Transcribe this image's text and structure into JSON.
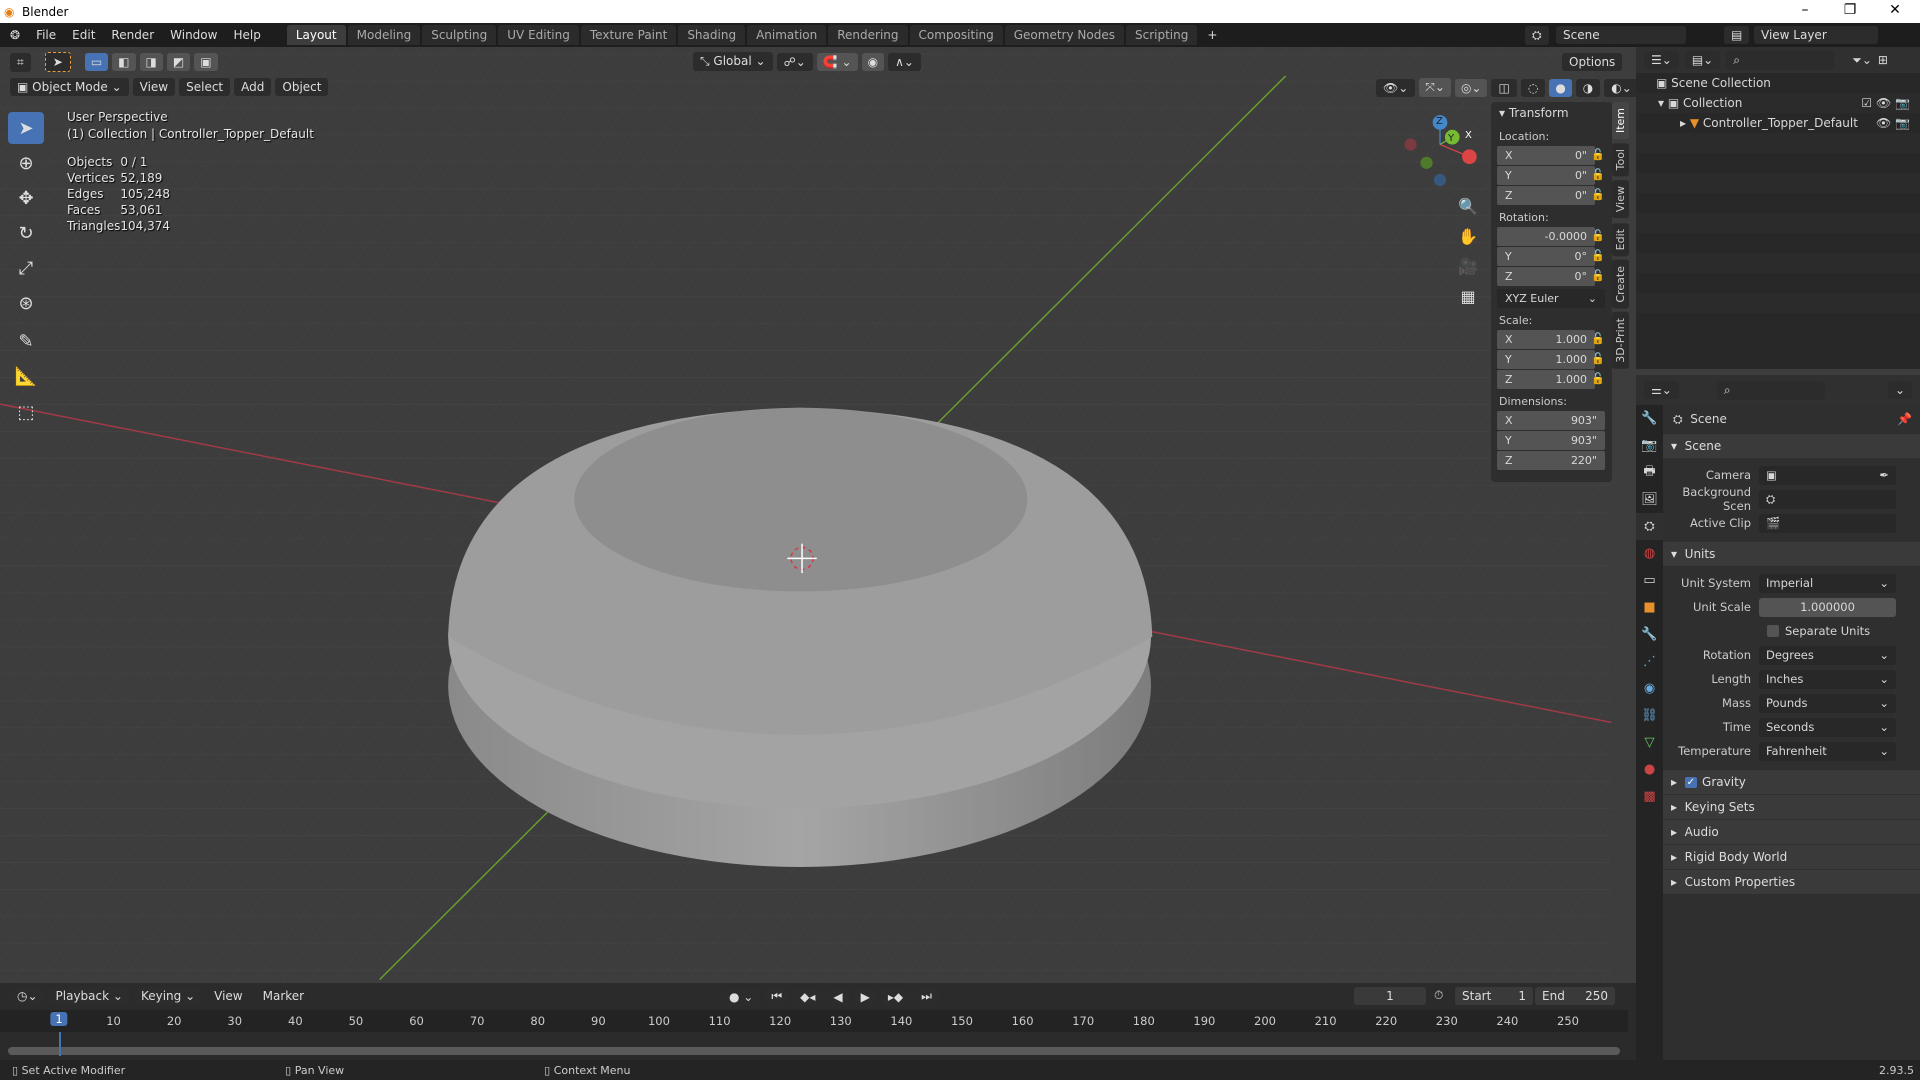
{
  "app_title": "Blender",
  "menu": [
    "File",
    "Edit",
    "Render",
    "Window",
    "Help"
  ],
  "workspaces": [
    "Layout",
    "Modeling",
    "Sculpting",
    "UV Editing",
    "Texture Paint",
    "Shading",
    "Animation",
    "Rendering",
    "Compositing",
    "Geometry Nodes",
    "Scripting"
  ],
  "active_workspace": "Layout",
  "add_workspace": "+",
  "scene_field": "Scene",
  "view_layer_field": "View Layer",
  "viewport_header": {
    "transform_orientation": "Global",
    "options": "Options",
    "mode": "Object Mode",
    "menus": [
      "View",
      "Select",
      "Add",
      "Object"
    ]
  },
  "viewport": {
    "perspective": "User Perspective",
    "collection_info": "(1) Collection | Controller_Topper_Default",
    "stats": [
      {
        "label": "Objects",
        "value": "0 / 1"
      },
      {
        "label": "Vertices",
        "value": "52,189"
      },
      {
        "label": "Edges",
        "value": "105,248"
      },
      {
        "label": "Faces",
        "value": "53,061"
      },
      {
        "label": "Triangles",
        "value": "104,374"
      }
    ],
    "gizmo": {
      "x": "X",
      "y": "Y",
      "z": "Z"
    },
    "axis_colors": {
      "x": "#a23a48",
      "y": "#6a9c2e"
    }
  },
  "tools": [
    "select-box",
    "cursor",
    "move",
    "rotate",
    "scale",
    "transform",
    "annotate",
    "measure",
    "add-cube"
  ],
  "npanel": {
    "title": "Transform",
    "location_label": "Location:",
    "location": [
      {
        "axis": "X",
        "value": "0\""
      },
      {
        "axis": "Y",
        "value": "0\""
      },
      {
        "axis": "Z",
        "value": "0\""
      }
    ],
    "rotation_label": "Rotation:",
    "rotation": [
      {
        "axis": "",
        "value": "-0.0000"
      },
      {
        "axis": "Y",
        "value": "0°"
      },
      {
        "axis": "Z",
        "value": "0°"
      }
    ],
    "rotation_mode": "XYZ Euler",
    "scale_label": "Scale:",
    "scale": [
      {
        "axis": "X",
        "value": "1.000"
      },
      {
        "axis": "Y",
        "value": "1.000"
      },
      {
        "axis": "Z",
        "value": "1.000"
      }
    ],
    "dimensions_label": "Dimensions:",
    "dimensions": [
      {
        "axis": "X",
        "value": "903\""
      },
      {
        "axis": "Y",
        "value": "903\""
      },
      {
        "axis": "Z",
        "value": "220\""
      }
    ],
    "tabs": [
      "Item",
      "Tool",
      "View",
      "Edit",
      "Create",
      "3D-Print"
    ]
  },
  "outliner": {
    "root": "Scene Collection",
    "collection": "Collection",
    "object": "Controller_Topper_Default"
  },
  "properties": {
    "context": "Scene",
    "scene_section": "Scene",
    "camera_label": "Camera",
    "background_label": "Background Scen",
    "active_clip_label": "Active Clip",
    "units_section": "Units",
    "unit_system_label": "Unit System",
    "unit_system": "Imperial",
    "unit_scale_label": "Unit Scale",
    "unit_scale": "1.000000",
    "separate_units": "Separate Units",
    "rotation_label": "Rotation",
    "rotation": "Degrees",
    "length_label": "Length",
    "length": "Inches",
    "mass_label": "Mass",
    "mass": "Pounds",
    "time_label": "Time",
    "time": "Seconds",
    "temperature_label": "Temperature",
    "temperature": "Fahrenheit",
    "collapsed": [
      "Gravity",
      "Keying Sets",
      "Audio",
      "Rigid Body World",
      "Custom Properties"
    ],
    "gravity_checked": true
  },
  "timeline": {
    "menus": [
      "Playback",
      "Keying",
      "View",
      "Marker"
    ],
    "current_frame": "1",
    "start_label": "Start",
    "start": "1",
    "end_label": "End",
    "end": "250",
    "ticks": [
      "1",
      "10",
      "20",
      "30",
      "40",
      "50",
      "60",
      "70",
      "80",
      "90",
      "100",
      "110",
      "120",
      "130",
      "140",
      "150",
      "160",
      "170",
      "180",
      "190",
      "200",
      "210",
      "220",
      "230",
      "240",
      "250"
    ]
  },
  "status": {
    "left": "Set Active Modifier",
    "middle": "Pan View",
    "right": "Context Menu",
    "version": "2.93.5"
  },
  "accent": "#4772b3"
}
